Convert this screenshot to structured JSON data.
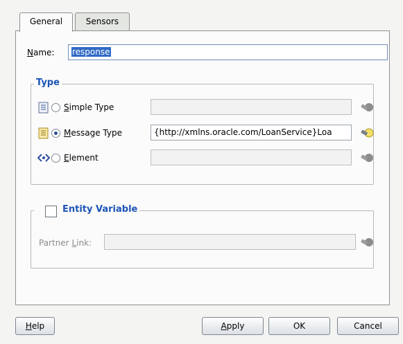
{
  "tabs": [
    {
      "label": "General"
    },
    {
      "label": "Sensors"
    }
  ],
  "name": {
    "label_mnemonic": "N",
    "label_rest": "ame:",
    "value": "response"
  },
  "type_group": {
    "legend": "Type",
    "simple": {
      "mn": "S",
      "rest": "imple Type",
      "value": "",
      "selected": false
    },
    "message": {
      "mn": "M",
      "rest": "essage Type",
      "value": "{http://xmlns.oracle.com/LoanService}Loa",
      "selected": true
    },
    "element": {
      "mn": "E",
      "rest": "lement",
      "value": "",
      "selected": false
    }
  },
  "entity_group": {
    "legend": "Entity Variable",
    "checked": false,
    "partner_link_pre": "Partner ",
    "partner_link_mn": "L",
    "partner_link_post": "ink:",
    "value": ""
  },
  "buttons": {
    "help_mn": "H",
    "help_rest": "elp",
    "apply_mn": "A",
    "apply_rest": "pply",
    "ok": "OK",
    "cancel": "Cancel"
  },
  "colors": {
    "legend": "#1c54b6",
    "selection": "#316ac5"
  }
}
